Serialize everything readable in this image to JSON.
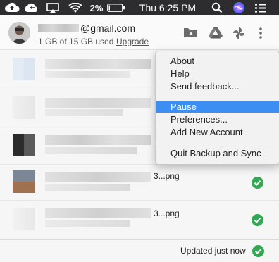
{
  "menubar": {
    "battery_percent": "2%",
    "clock": "Thu 6:25 PM",
    "icons": [
      "backup-and-sync-icon",
      "cloud-icon",
      "airplay-icon",
      "wifi-icon",
      "battery-icon",
      "search-icon",
      "siri-icon",
      "notification-center-icon"
    ]
  },
  "account": {
    "email_suffix": "@gmail.com",
    "storage_text": "1 GB of 15 GB used",
    "upgrade_label": "Upgrade"
  },
  "header_icons": [
    "folder-icon",
    "google-drive-icon",
    "google-photos-icon",
    "more-options-icon"
  ],
  "files": [
    {
      "name": ""
    },
    {
      "name": ""
    },
    {
      "name": ""
    },
    {
      "name": "3...png"
    },
    {
      "name": "3...png"
    }
  ],
  "status": {
    "text": "Updated just now"
  },
  "menu": {
    "items": [
      {
        "label": "About"
      },
      {
        "label": "Help"
      },
      {
        "label": "Send feedback..."
      },
      {
        "label": "Pause"
      },
      {
        "label": "Preferences..."
      },
      {
        "label": "Add New Account"
      },
      {
        "label": "Quit Backup and Sync"
      }
    ],
    "selected_index": 3
  },
  "colors": {
    "menubar": "#2d2d2f",
    "selection": "#3d8ef3",
    "check": "#34a853"
  }
}
